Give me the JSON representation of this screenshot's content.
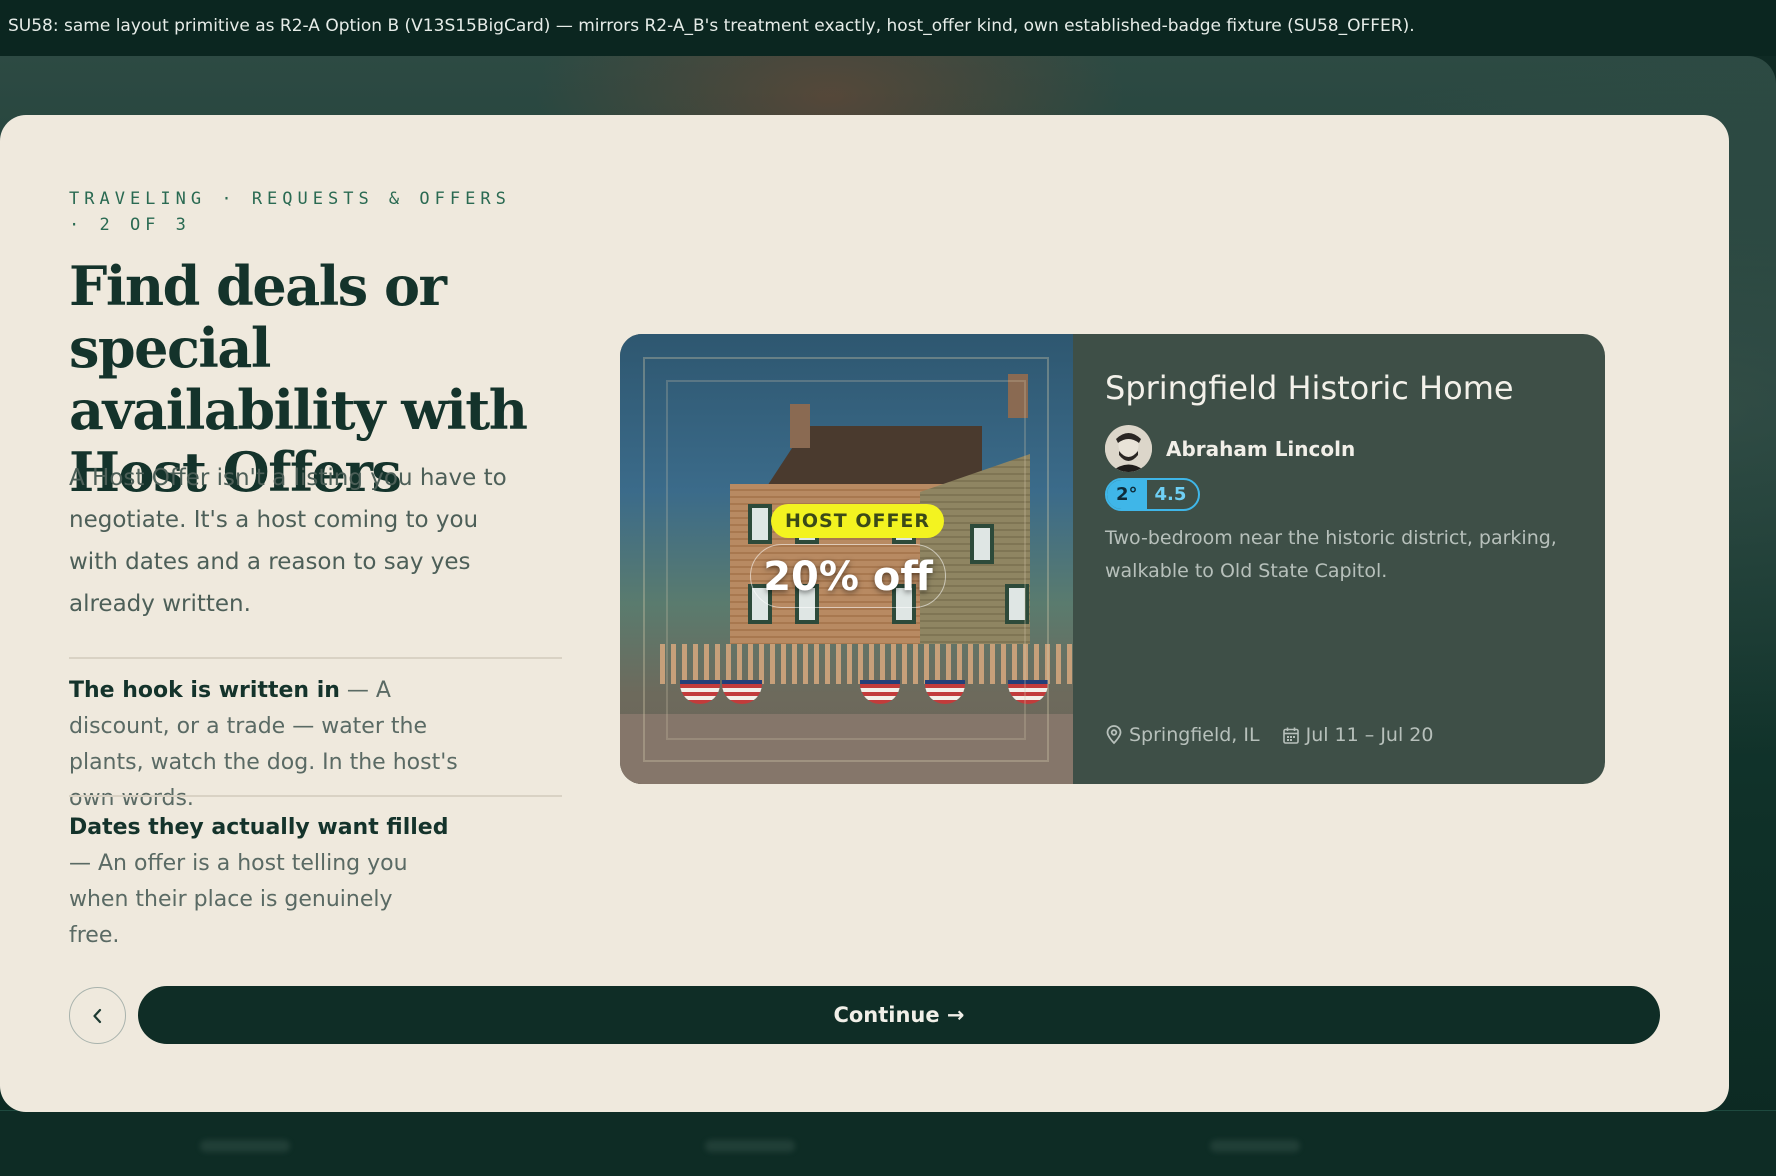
{
  "banner": {
    "text": "SU58: same layout primitive as R2-A Option B (V13S15BigCard) — mirrors R2-A_B's treatment exactly, host_offer kind, own established-badge fixture (SU58_OFFER)."
  },
  "intro": {
    "eyebrow": "TRAVELING · REQUESTS & OFFERS · 2 OF 3",
    "headline": "Find deals or special availability with Host Offers",
    "lede": "A Host Offer isn't a listing you have to negotiate. It's a host coming to you with dates and a reason to say yes already written.",
    "points": [
      {
        "title": "The hook is written in",
        "body": " — A discount, or a trade — water the plants, watch the dog. In the host's own words."
      },
      {
        "title": "Dates they actually want filled",
        "body": " — An offer is a host telling you when their place is genuinely free."
      }
    ]
  },
  "listing": {
    "badge": "HOST OFFER",
    "discount": "20% off",
    "title": "Springfield Historic Home",
    "host_name": "Abraham Lincoln",
    "degree": "2°",
    "rating": "4.5",
    "description": "Two-bedroom near the historic district, parking, walkable to Old State Capitol.",
    "location": "Springfield, IL",
    "dates": "Jul 11 – Jul 20",
    "icons": [
      "location-pin-icon",
      "calendar-icon"
    ]
  },
  "footer": {
    "back_icon": "chevron-left-icon",
    "continue_label": "Continue →"
  },
  "colors": {
    "background": "#0f2a24",
    "modal": "#efe9dd",
    "primary": "#0f2d26",
    "offer_badge": "#f3f320",
    "degree_pill": "#3fb6e8"
  }
}
